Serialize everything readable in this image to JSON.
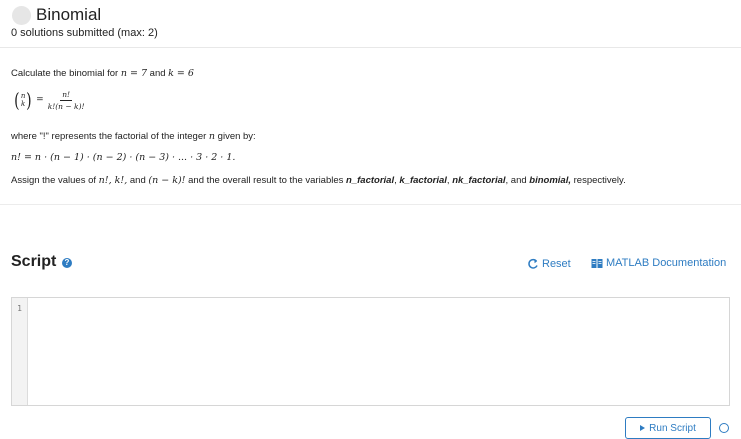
{
  "header": {
    "title": "Binomial",
    "subtitle": "0 solutions submitted (max: 2)"
  },
  "problem": {
    "line1_prefix": "Calculate the binomial for ",
    "line1_n": "n = 7",
    "line1_and": " and ",
    "line1_k": "k = 6",
    "formula": {
      "top": "n",
      "bottom": "k",
      "eq": "=",
      "numerator": "n!",
      "denominator": "k!(n − k)!"
    },
    "where_prefix": "where  \"!\" represents the factorial of the integer ",
    "where_n": "n",
    "where_suffix": " given by:",
    "factorial_formula": "n! = n · (n − 1) · (n − 2) · (n − 3) · ... · 3 · 2 · 1.",
    "assign_prefix": "Assign the values of ",
    "assign_math1": "n!, k!,",
    "assign_and": " and ",
    "assign_math2": "(n − k)!",
    "assign_mid": " and the overall result to the variables ",
    "var1": "n_factorial",
    "comma1": ", ",
    "var2": "k_factorial",
    "comma2": ", ",
    "var3": "nk_factorial",
    "comma3": ", and ",
    "var4": "binomial,",
    "assign_end": " respectively."
  },
  "script": {
    "label": "Script",
    "help_icon": "question-circle-icon",
    "reset_label": "Reset",
    "reset_icon": "refresh-icon",
    "doc_label": "MATLAB Documentation",
    "doc_icon": "book-icon",
    "line_numbers": [
      "1"
    ],
    "code": ""
  },
  "run": {
    "label": "Run Script",
    "icon": "play-icon"
  },
  "colors": {
    "accent": "#2e7cc2",
    "status_circle": "#e6e6e6"
  }
}
